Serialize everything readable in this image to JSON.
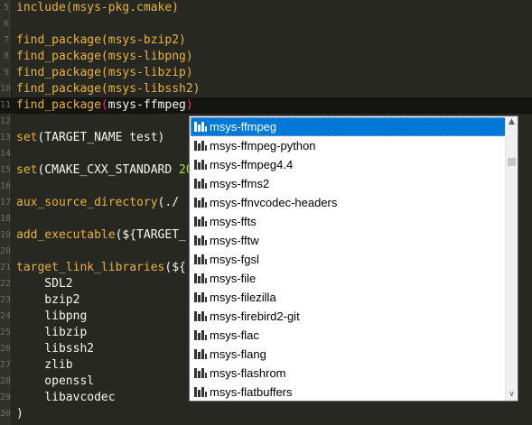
{
  "editor": {
    "lines": [
      {
        "num": "5",
        "segments": [
          {
            "t": "include(msys-pkg.cmake)",
            "c": "kw"
          }
        ]
      },
      {
        "num": "6",
        "segments": []
      },
      {
        "num": "7",
        "segments": [
          {
            "t": "find_package",
            "c": "kw"
          },
          {
            "t": "(msys-bzip2)",
            "c": "kw"
          }
        ]
      },
      {
        "num": "8",
        "segments": [
          {
            "t": "find_package",
            "c": "kw"
          },
          {
            "t": "(msys-libpng)",
            "c": "kw"
          }
        ]
      },
      {
        "num": "9",
        "segments": [
          {
            "t": "find_package",
            "c": "kw"
          },
          {
            "t": "(msys-libzip)",
            "c": "kw"
          }
        ]
      },
      {
        "num": "10",
        "segments": [
          {
            "t": "find_package",
            "c": "kw"
          },
          {
            "t": "(msys-libssh2)",
            "c": "kw"
          }
        ]
      },
      {
        "num": "11",
        "current": true,
        "segments": [
          {
            "t": "find_package",
            "c": "kw"
          },
          {
            "t": "(",
            "c": "paren-hl"
          },
          {
            "t": "msys-ffmpeg",
            "c": "plain"
          },
          {
            "t": ")",
            "c": "paren-hl"
          }
        ]
      },
      {
        "num": "12",
        "segments": []
      },
      {
        "num": "13",
        "segments": [
          {
            "t": "set",
            "c": "kw"
          },
          {
            "t": "(TARGET_NAME test)",
            "c": "plain"
          }
        ]
      },
      {
        "num": "14",
        "segments": []
      },
      {
        "num": "15",
        "segments": [
          {
            "t": "set",
            "c": "kw"
          },
          {
            "t": "(CMAKE_CXX_STANDARD ",
            "c": "plain"
          },
          {
            "t": "20",
            "c": "num"
          }
        ]
      },
      {
        "num": "16",
        "segments": []
      },
      {
        "num": "17",
        "segments": [
          {
            "t": "aux_source_directory",
            "c": "kw"
          },
          {
            "t": "(./ ",
            "c": "plain"
          }
        ]
      },
      {
        "num": "18",
        "segments": []
      },
      {
        "num": "19",
        "segments": [
          {
            "t": "add_executable",
            "c": "kw"
          },
          {
            "t": "(${TARGET_",
            "c": "plain"
          }
        ]
      },
      {
        "num": "20",
        "segments": []
      },
      {
        "num": "21",
        "segments": [
          {
            "t": "target_link_libraries",
            "c": "kw"
          },
          {
            "t": "(${",
            "c": "plain"
          }
        ]
      },
      {
        "num": "22",
        "segments": [
          {
            "t": "    SDL2",
            "c": "plain"
          }
        ]
      },
      {
        "num": "23",
        "segments": [
          {
            "t": "    bzip2",
            "c": "plain"
          }
        ]
      },
      {
        "num": "24",
        "segments": [
          {
            "t": "    libpng",
            "c": "plain"
          }
        ]
      },
      {
        "num": "25",
        "segments": [
          {
            "t": "    libzip",
            "c": "plain"
          }
        ]
      },
      {
        "num": "26",
        "segments": [
          {
            "t": "    libssh2",
            "c": "plain"
          }
        ]
      },
      {
        "num": "27",
        "segments": [
          {
            "t": "    zlib",
            "c": "plain"
          }
        ]
      },
      {
        "num": "28",
        "segments": [
          {
            "t": "    openssl",
            "c": "plain"
          }
        ]
      },
      {
        "num": "29",
        "segments": [
          {
            "t": "    libavcodec",
            "c": "plain"
          }
        ]
      },
      {
        "num": "30",
        "segments": [
          {
            "t": ")",
            "c": "plain"
          }
        ]
      }
    ]
  },
  "autocomplete": {
    "selected_index": 0,
    "items": [
      "msys-ffmpeg",
      "msys-ffmpeg-python",
      "msys-ffmpeg4.4",
      "msys-ffms2",
      "msys-ffnvcodec-headers",
      "msys-ffts",
      "msys-fftw",
      "msys-fgsl",
      "msys-file",
      "msys-filezilla",
      "msys-firebird2-git",
      "msys-flac",
      "msys-flang",
      "msys-flashrom",
      "msys-flatbuffers"
    ],
    "scroll_up_glyph": "▲",
    "scroll_down_glyph": "∨",
    "item_icon": "package-icon"
  },
  "colors": {
    "background": "#272822",
    "keyword": "#e8b33a",
    "text": "#f8f8f2",
    "number": "#a6e22e",
    "bracket_match": "#f92672",
    "selection": "#0078d7"
  }
}
